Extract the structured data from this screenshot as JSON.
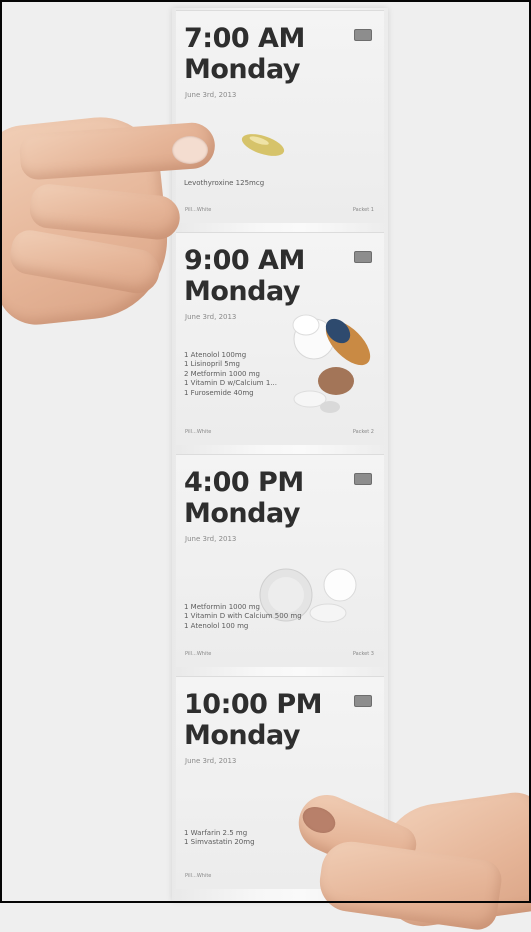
{
  "packets": [
    {
      "time": "7:00 AM",
      "day": "Monday",
      "date": "June 3rd, 2013",
      "medications": [
        "Levothyroxine 125mcg"
      ],
      "footer_left": "Pill...White",
      "footer_right": "Packet 1"
    },
    {
      "time": "9:00 AM",
      "day": "Monday",
      "date": "June 3rd, 2013",
      "medications": [
        "1 Atenolol 100mg",
        "1 Lisinopril 5mg",
        "2 Metformin 1000 mg",
        "1 Vitamin D w/Calcium 1...",
        "1 Furosemide 40mg"
      ],
      "footer_left": "Pill...White",
      "footer_right": "Packet 2"
    },
    {
      "time": "4:00 PM",
      "day": "Monday",
      "date": "June 3rd, 2013",
      "medications": [
        "1 Metformin 1000 mg",
        "1 Vitamin D with Calcium 500 mg",
        "1 Atenolol 100 mg"
      ],
      "footer_left": "Pill...White",
      "footer_right": "Packet 3"
    },
    {
      "time": "10:00 PM",
      "day": "Monday",
      "date": "June 3rd, 2013",
      "medications": [
        "1 Warfarin 2.5 mg",
        "1 Simvastatin 20mg"
      ],
      "footer_left": "Pill...White",
      "footer_right": ""
    }
  ],
  "colors": {
    "background": "#efefef",
    "packet": "#f2f2f2",
    "heading_text": "#2e2e2e",
    "skin": "#e5b497"
  }
}
